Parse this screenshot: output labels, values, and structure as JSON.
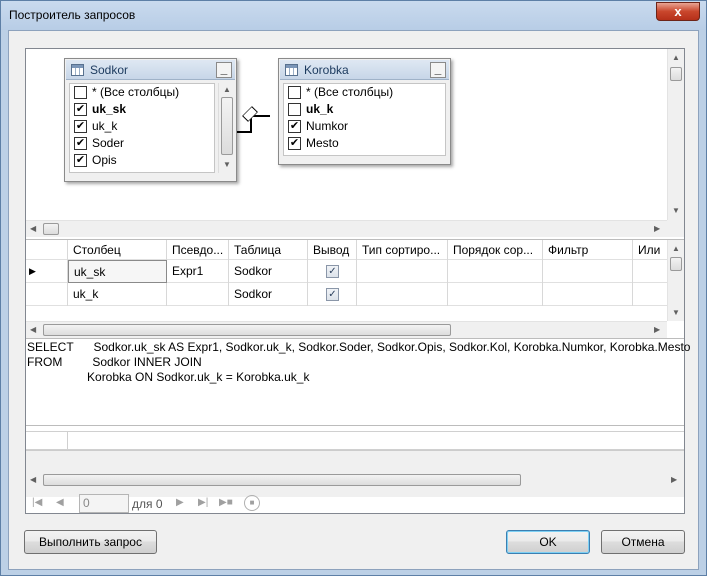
{
  "window": {
    "title": "Построитель запросов",
    "close_glyph": "x"
  },
  "diagram": {
    "tables": [
      {
        "name": "Sodkor",
        "columns": [
          {
            "label": "* (Все столбцы)",
            "checked": false,
            "bold": false
          },
          {
            "label": "uk_sk",
            "checked": true,
            "bold": true
          },
          {
            "label": "uk_k",
            "checked": true,
            "bold": false
          },
          {
            "label": "Soder",
            "checked": true,
            "bold": false
          },
          {
            "label": "Opis",
            "checked": true,
            "bold": false
          }
        ]
      },
      {
        "name": "Korobka",
        "columns": [
          {
            "label": "* (Все столбцы)",
            "checked": false,
            "bold": false
          },
          {
            "label": "uk_k",
            "checked": false,
            "bold": true
          },
          {
            "label": "Numkor",
            "checked": true,
            "bold": false
          },
          {
            "label": "Mesto",
            "checked": true,
            "bold": false
          }
        ]
      }
    ],
    "minimize_glyph": "_",
    "check_glyph": "✔"
  },
  "grid": {
    "headers": [
      "Столбец",
      "Псевдо...",
      "Таблица",
      "Вывод",
      "Тип сортиро...",
      "Порядок сор...",
      "Фильтр",
      "Или"
    ],
    "rows": [
      {
        "column": "uk_sk",
        "alias": "Expr1",
        "table": "Sodkor",
        "output": true,
        "current": true
      },
      {
        "column": "uk_k",
        "alias": "",
        "table": "Sodkor",
        "output": true,
        "current": false
      }
    ],
    "check_glyph": "✓",
    "row_pointer_glyph": "▶"
  },
  "sql": {
    "lines": [
      "SELECT      Sodkor.uk_sk AS Expr1, Sodkor.uk_k, Sodkor.Soder, Sodkor.Opis, Sodkor.Kol, Korobka.Numkor, Korobka.Mesto",
      "FROM         Sodkor INNER JOIN",
      "                  Korobka ON Sodkor.uk_k = Korobka.uk_k"
    ]
  },
  "results": {
    "navigator": {
      "position_value": "0",
      "of_label": "для 0"
    }
  },
  "buttons": {
    "execute_label": "Выполнить запрос",
    "ok_label": "OK",
    "cancel_label": "Отмена"
  }
}
